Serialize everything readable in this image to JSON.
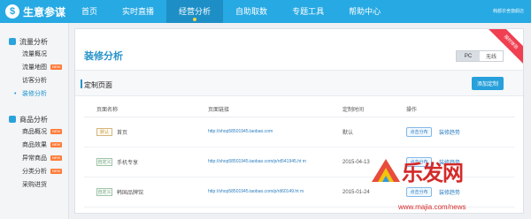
{
  "app": {
    "name": "生意参谋",
    "logo_char": "$"
  },
  "nav": [
    {
      "label": "首页",
      "active": false
    },
    {
      "label": "实时直播",
      "active": false
    },
    {
      "label": "经营分析",
      "active": true
    },
    {
      "label": "自助取数",
      "active": false
    },
    {
      "label": "专题工具",
      "active": false
    },
    {
      "label": "帮助中心",
      "active": false
    }
  ],
  "user": {
    "text": "韩都衣舍旗舰店"
  },
  "sidebar": {
    "groups": [
      {
        "title": "流量分析",
        "items": [
          {
            "label": "流量概况",
            "badge": ""
          },
          {
            "label": "流量地图",
            "badge": "NEW"
          },
          {
            "label": "访客分析",
            "badge": ""
          },
          {
            "label": "装修分析",
            "badge": "",
            "active": true
          }
        ]
      },
      {
        "title": "商品分析",
        "items": [
          {
            "label": "商品概况",
            "badge": "NEW"
          },
          {
            "label": "商品效果",
            "badge": "NEW"
          },
          {
            "label": "异常商品",
            "badge": "NEW"
          },
          {
            "label": "分类分析",
            "badge": "NEW"
          },
          {
            "label": "采购进货",
            "badge": ""
          }
        ]
      }
    ]
  },
  "page": {
    "title": "装修分析",
    "ribbon": "限时体验",
    "toggle": {
      "pc": "PC",
      "wireless": "无线"
    },
    "section_title": "定制页面",
    "add_button": "添加定制"
  },
  "table": {
    "headers": [
      "页面名称",
      "页面链接",
      "定制时间",
      "操作"
    ],
    "rows": [
      {
        "tag": "默认",
        "name": "首页",
        "link": "http://shop58501945.taobao.com",
        "time": "默认",
        "share": "点击分布",
        "trend": "装修趋势"
      },
      {
        "tag": "自定义",
        "name": "手机专享",
        "link": "http://shop58501945.taobao.com/p/rd541945.ht m",
        "time": "2015-04-13",
        "share": "点击分布",
        "trend": "装修趋势"
      },
      {
        "tag": "自定义",
        "name": "韩国品牌馆",
        "link": "http://shop58501945.taobao.com/p/rd60149.ht m",
        "time": "2015-01-24",
        "share": "点击分布",
        "trend": "装修趋势"
      }
    ]
  },
  "watermark": {
    "text": "乐发网",
    "url": "www.majia.com/news"
  },
  "colors": {
    "topbar": "#27a9e3",
    "accent": "#2793ca",
    "ribbon": "#ef3f51"
  }
}
